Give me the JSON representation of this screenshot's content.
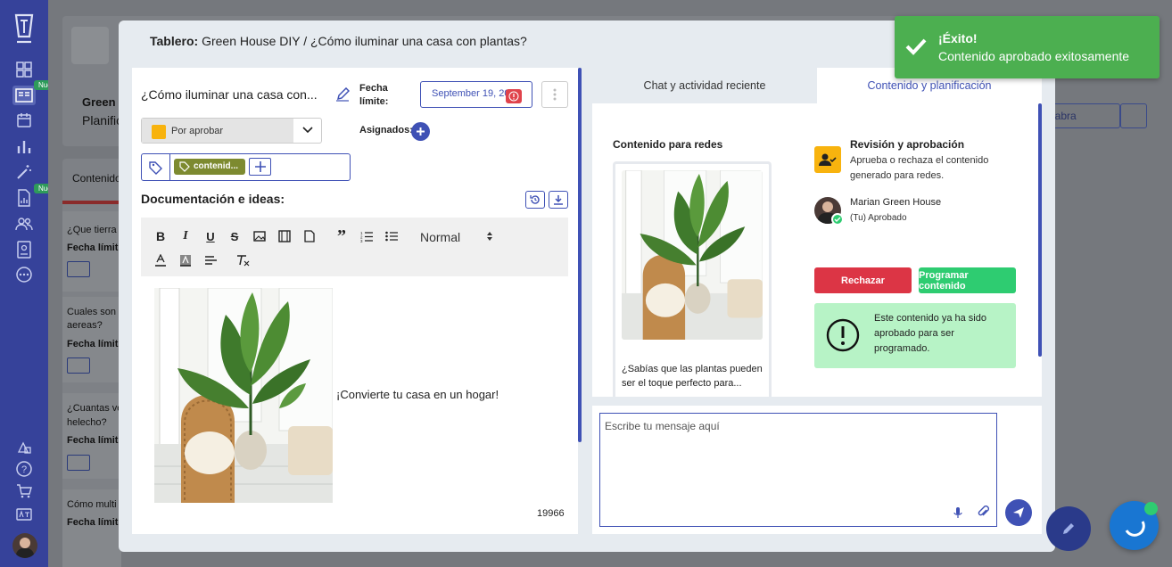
{
  "modal": {
    "title_prefix": "Tablero:",
    "title_path": "Green House DIY / ¿Cómo iluminar una casa con plantas?"
  },
  "doc": {
    "title": "¿Cómo iluminar una casa con...",
    "due_label_1": "Fecha",
    "due_label_2": "límite:",
    "due_date": "September 19, 20",
    "status": "Por aprobar",
    "assignees_label": "Asignados:",
    "tag": "contenid...",
    "section_title": "Documentación e ideas:",
    "format_select": "Normal",
    "image_caption": "¡Convierte tu casa en un hogar!",
    "char_count": "19966"
  },
  "tabs": {
    "chat": "Chat y actividad reciente",
    "content": "Contenido y planificación"
  },
  "content_panel": {
    "social_title": "Contenido para redes",
    "post_text_1": "¿Sabías que las plantas pueden",
    "post_text_2": "ser el toque perfecto para...",
    "review_title": "Revisión y aprobación",
    "review_desc_1": "Aprueba o rechaza el contenido",
    "review_desc_2": "generado para redes.",
    "reviewer_name": "Marian Green House",
    "reviewer_status": "(Tu) Aprobado",
    "reject_btn": "Rechazar",
    "schedule_btn": "Programar contenido",
    "notice_1": "Este contenido ya ha sido",
    "notice_2": "aprobado para ser",
    "notice_3": "programado."
  },
  "chat": {
    "placeholder": "Escribe tu mensaje aquí"
  },
  "toast": {
    "title": "¡Éxito!",
    "message": "Contenido aprobado exitosamente"
  },
  "sidebar": {
    "badge_1": "Nuevo",
    "badge_2": "Nuevo"
  },
  "background": {
    "board_name": "Green",
    "board_sub": "Planific",
    "tab_label": "Contenido",
    "search_hint": "labra",
    "cards": [
      {
        "l1": "¿Que tierra c",
        "l2": "",
        "meta": "Fecha límite"
      },
      {
        "l1": "Cuales son",
        "l2": "aereas?",
        "meta": "Fecha límite"
      },
      {
        "l1": "¿Cuantas ve",
        "l2": "helecho?",
        "meta": "Fecha límite"
      },
      {
        "l1": "Cómo multi",
        "l2": "",
        "meta": "Fecha límite"
      }
    ]
  },
  "colors": {
    "sidebar": "#36429a",
    "accent": "#3f51b5",
    "success": "#4caf50",
    "reject": "#dc3545",
    "approve": "#2ecc71",
    "status": "#f8b30e"
  }
}
